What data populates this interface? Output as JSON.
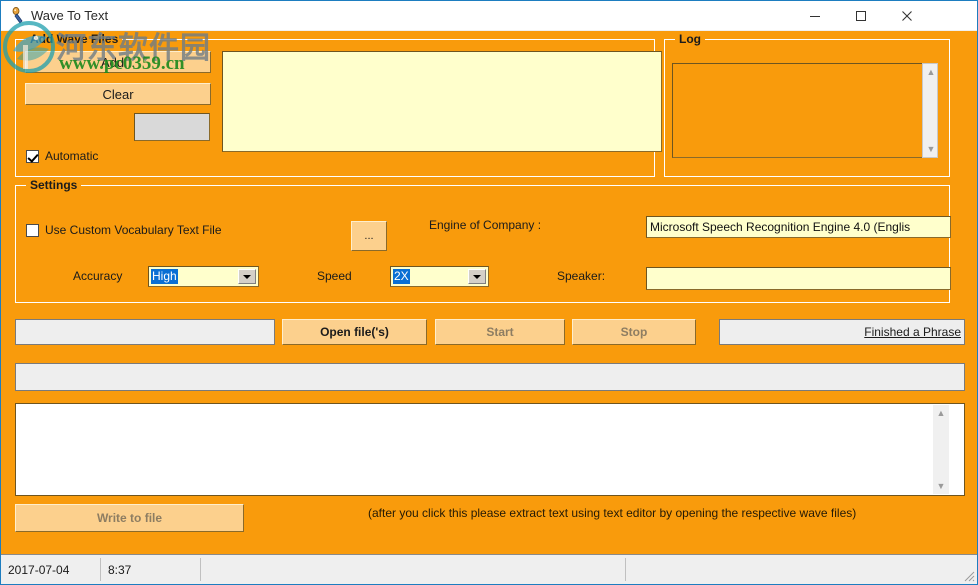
{
  "window": {
    "title": "Wave To Text",
    "app_icon": "microphone-icon",
    "controls": {
      "minimize": "minimize-icon",
      "maximize": "maximize-icon",
      "close": "close-icon"
    },
    "accent_orange": "#F99B0C",
    "field_cream": "#FFFFCC",
    "button_amber": "#FCD08D"
  },
  "watermark": {
    "cn_text": "河东软件园",
    "url_text": "www.pc0359.cn",
    "logo": "circle-logo-icon"
  },
  "add_wave_files": {
    "title": "Add Wave Files",
    "add_button": "Add...",
    "clear_button": "Clear",
    "count_field_value": "",
    "automatic_label": "Automatic",
    "automatic_checked": true,
    "file_list_value": ""
  },
  "log": {
    "title": "Log",
    "value": ""
  },
  "settings": {
    "title": "Settings",
    "use_custom_vocab_label": "Use Custom Vocabulary Text File",
    "use_custom_vocab_checked": false,
    "browse_button": "...",
    "engine_label": "Engine of Company :",
    "engine_value": "Microsoft Speech Recognition Engine 4.0 (Englis",
    "accuracy_label": "Accuracy",
    "accuracy_value": "High",
    "speed_label": "Speed",
    "speed_value": "2X",
    "speaker_label": "Speaker:",
    "speaker_value": ""
  },
  "actions": {
    "path_field_value": "",
    "open_files_button": "Open file('s)",
    "start_button": "Start",
    "stop_button": "Stop",
    "phrase_status": "Finished a Phrase",
    "progress_value": "",
    "transcript_value": "",
    "write_to_file_button": "Write to file",
    "write_hint": "(after you click this please extract text using text editor by opening the respective wave files)"
  },
  "statusbar": {
    "date": "2017-07-04",
    "time": "8:37",
    "message": ""
  }
}
